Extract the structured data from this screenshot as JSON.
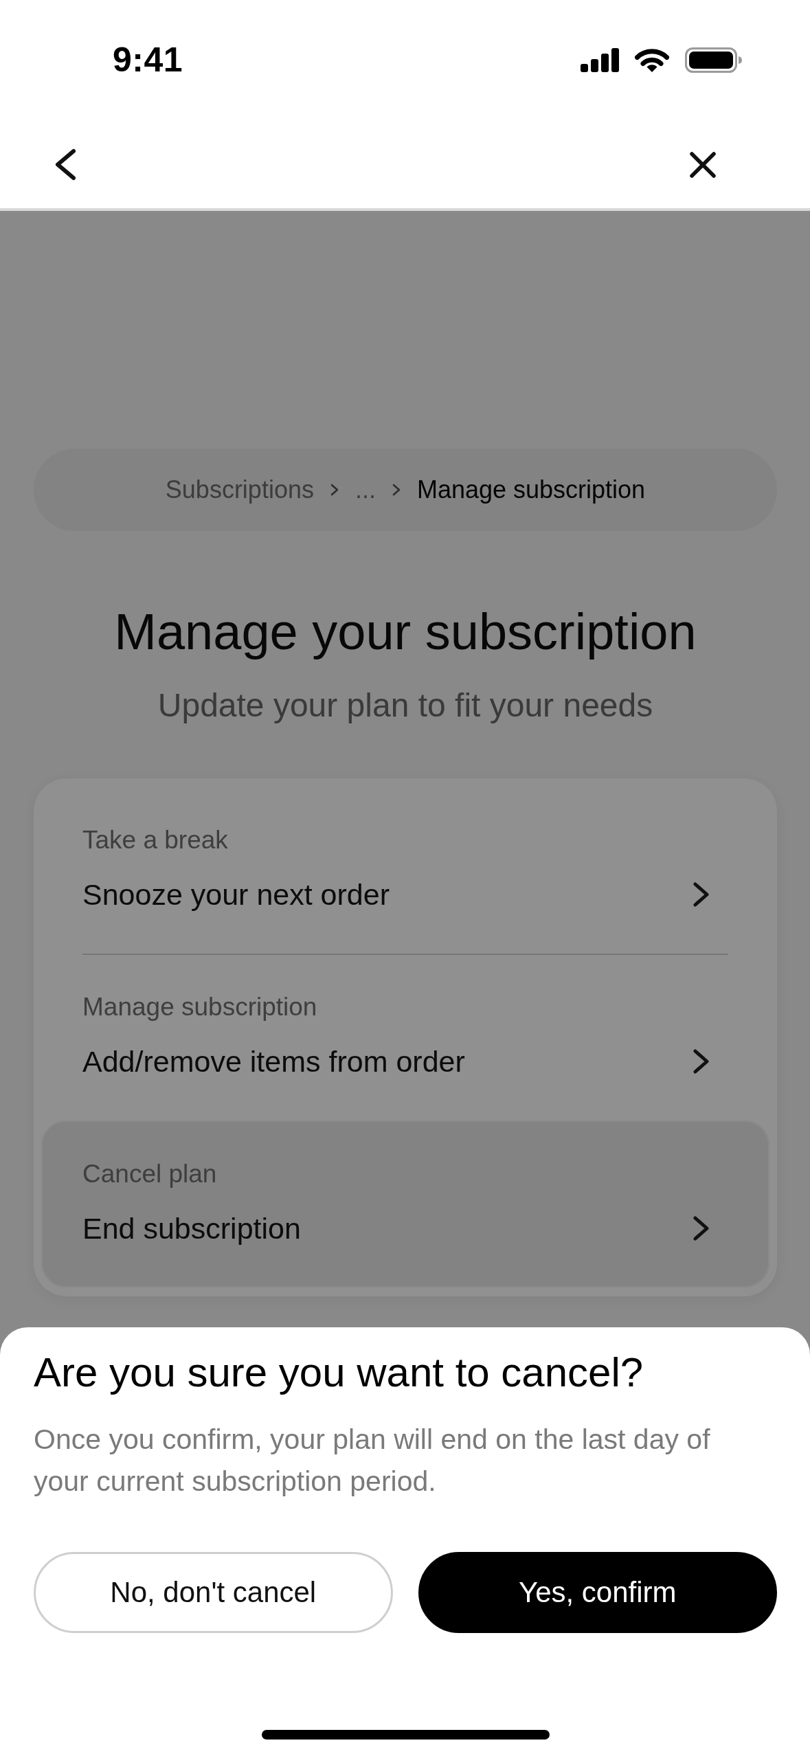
{
  "status_bar": {
    "time": "9:41"
  },
  "breadcrumb": [
    {
      "label": "Subscriptions",
      "current": false
    },
    {
      "label": "...",
      "current": false
    },
    {
      "label": "Manage subscription",
      "current": true
    }
  ],
  "header": {
    "title": "Manage your subscription",
    "subtitle": "Update your plan to fit your needs"
  },
  "options": [
    {
      "label": "Take a break",
      "title": "Snooze your next order",
      "selected": false
    },
    {
      "label": "Manage subscription",
      "title": "Add/remove items from order",
      "selected": false
    },
    {
      "label": "Cancel plan",
      "title": "End subscription",
      "selected": true
    }
  ],
  "dialog": {
    "title": "Are you sure you want to cancel?",
    "message": "Once you confirm, your plan will end on the last day of your current subscription period.",
    "buttons": [
      {
        "label": "No, don't cancel",
        "kind": "secondary"
      },
      {
        "label": "Yes, confirm",
        "kind": "primary"
      }
    ]
  }
}
